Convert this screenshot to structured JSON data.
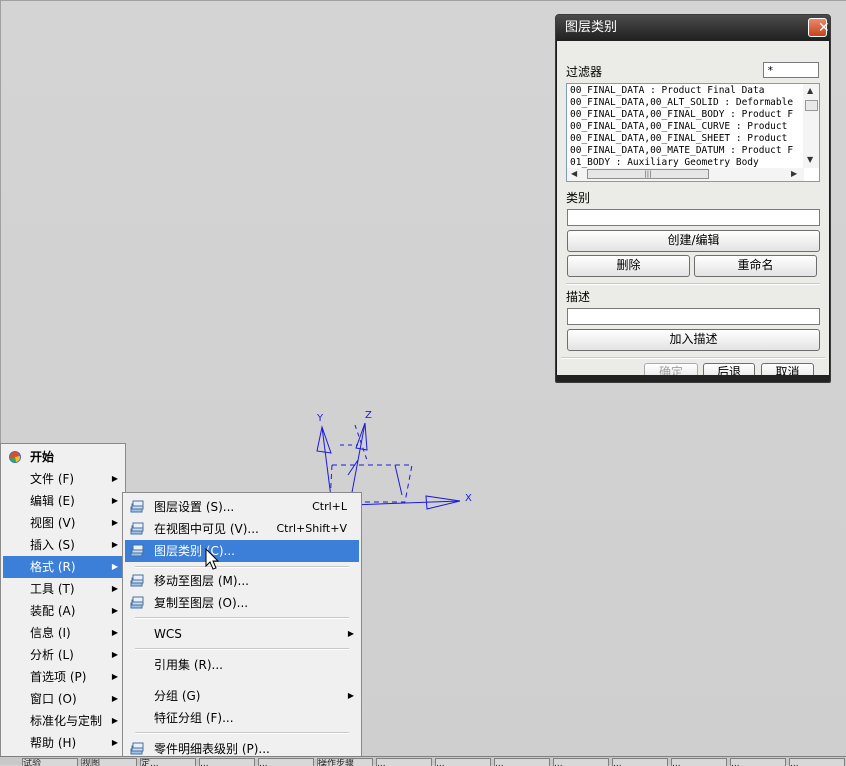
{
  "dialog": {
    "title": "图层类别",
    "close_label": "✕",
    "filter_label": "过滤器",
    "filter_value": "*",
    "list_items": [
      "00_FINAL_DATA : Product Final Data",
      "00_FINAL_DATA,00_ALT_SOLID : Deformable",
      "00_FINAL_DATA,00_FINAL_BODY : Product F",
      "00_FINAL_DATA,00_FINAL_CURVE : Product",
      "00_FINAL_DATA,00_FINAL_SHEET : Product",
      "00_FINAL_DATA,00_MATE_DATUM : Product F",
      "01_BODY : Auxiliary Geometry Body"
    ],
    "category_label": "类别",
    "category_value": "",
    "create_edit_label": "创建/编辑",
    "delete_label": "删除",
    "rename_label": "重命名",
    "description_label": "描述",
    "description_value": "",
    "add_description_label": "加入描述",
    "ok_label": "确定",
    "back_label": "后退",
    "cancel_label": "取消"
  },
  "axes": {
    "x": "X",
    "y": "Y",
    "z": "Z"
  },
  "start_menu": {
    "title": "开始",
    "items": [
      {
        "label": "文件 (F)"
      },
      {
        "label": "编辑 (E)"
      },
      {
        "label": "视图 (V)"
      },
      {
        "label": "插入 (S)"
      },
      {
        "label": "格式 (R)"
      },
      {
        "label": "工具 (T)"
      },
      {
        "label": "装配 (A)"
      },
      {
        "label": "信息 (I)"
      },
      {
        "label": "分析 (L)"
      },
      {
        "label": "首选项 (P)"
      },
      {
        "label": "窗口 (O)"
      },
      {
        "label": "标准化与定制"
      },
      {
        "label": "帮助 (H)"
      }
    ]
  },
  "format_menu": {
    "items": [
      {
        "label": "图层设置 (S)...",
        "shortcut": "Ctrl+L"
      },
      {
        "label": "在视图中可见 (V)...",
        "shortcut": "Ctrl+Shift+V"
      },
      {
        "label": "图层类别 (C)...",
        "shortcut": ""
      },
      {
        "label": "移动至图层 (M)...",
        "shortcut": ""
      },
      {
        "label": "复制至图层 (O)...",
        "shortcut": ""
      },
      {
        "label": "WCS",
        "shortcut": ""
      },
      {
        "label": "引用集 (R)...",
        "shortcut": ""
      },
      {
        "label": "分组 (G)",
        "shortcut": ""
      },
      {
        "label": "特征分组 (F)...",
        "shortcut": ""
      },
      {
        "label": "零件明细表级别 (P)...",
        "shortcut": ""
      }
    ]
  },
  "taskbar": {
    "items": [
      "试验",
      "视图",
      "定...",
      "...",
      "...",
      "操作步骤",
      "...",
      "...",
      "...",
      "...",
      "...",
      "...",
      "...",
      "..."
    ]
  }
}
